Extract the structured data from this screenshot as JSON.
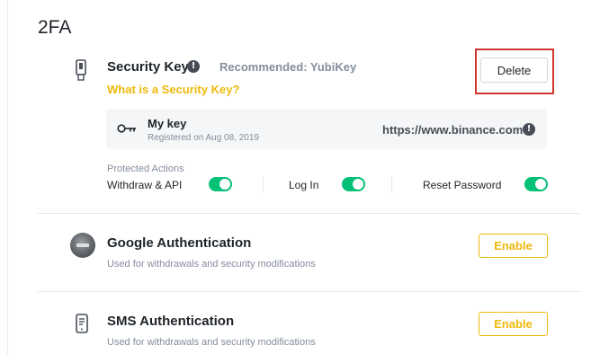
{
  "page": {
    "title": "2FA"
  },
  "security_key": {
    "title": "Security Key",
    "info_glyph": "!",
    "recommended": "Recommended: YubiKey",
    "link": "What is a Security Key?",
    "delete_label": "Delete",
    "icon": "usb-key-icon",
    "key": {
      "name": "My key",
      "registered": "Registered on Aug 08, 2019",
      "url": "https://www.binance.com",
      "icon": "key-icon"
    },
    "protected_actions_label": "Protected Actions",
    "actions": [
      {
        "label": "Withdraw & API",
        "enabled": true
      },
      {
        "label": "Log In",
        "enabled": true
      },
      {
        "label": "Reset Password",
        "enabled": true
      }
    ]
  },
  "google_auth": {
    "title": "Google Authentication",
    "description": "Used for withdrawals and security modifications",
    "enable_label": "Enable",
    "icon": "google-authenticator-icon"
  },
  "sms_auth": {
    "title": "SMS Authentication",
    "description": "Used for withdrawals and security modifications",
    "enable_label": "Enable",
    "icon": "phone-icon"
  },
  "colors": {
    "accent": "#f0b90b",
    "toggle_on": "#02c076",
    "highlight": "#d0352e",
    "text": "#1e2329",
    "muted": "#848e9c"
  }
}
